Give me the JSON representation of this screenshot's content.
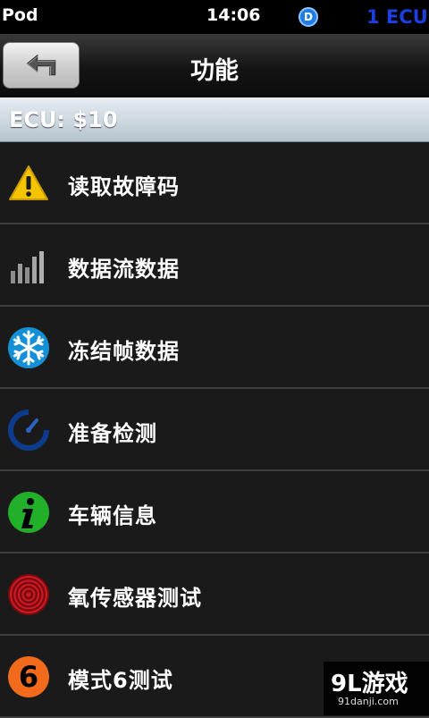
{
  "status_bar": {
    "carrier": "Pod",
    "time": "14:06",
    "badge": "D",
    "ecu_count": "1 ECU"
  },
  "nav": {
    "title": "功能",
    "back_icon": "back-arrow-icon"
  },
  "ecu": {
    "label": "ECU: $10"
  },
  "menu": [
    {
      "label": "读取故障码",
      "icon": "warning-icon"
    },
    {
      "label": "数据流数据",
      "icon": "bar-chart-icon"
    },
    {
      "label": "冻结帧数据",
      "icon": "snowflake-icon"
    },
    {
      "label": "准备检测",
      "icon": "readiness-gauge-icon"
    },
    {
      "label": "车辆信息",
      "icon": "info-icon"
    },
    {
      "label": "氧传感器测试",
      "icon": "oxygen-sensor-icon"
    },
    {
      "label": "模式6测试",
      "icon": "mode-six-icon"
    }
  ],
  "watermark": {
    "logo": "9L游戏",
    "url": "91danji.com"
  },
  "colors": {
    "accent_blue": "#1c3fe0",
    "warning_yellow": "#f5c400",
    "info_green": "#22b02a",
    "sensor_red": "#c0141e",
    "mode_orange": "#f26a1b"
  }
}
